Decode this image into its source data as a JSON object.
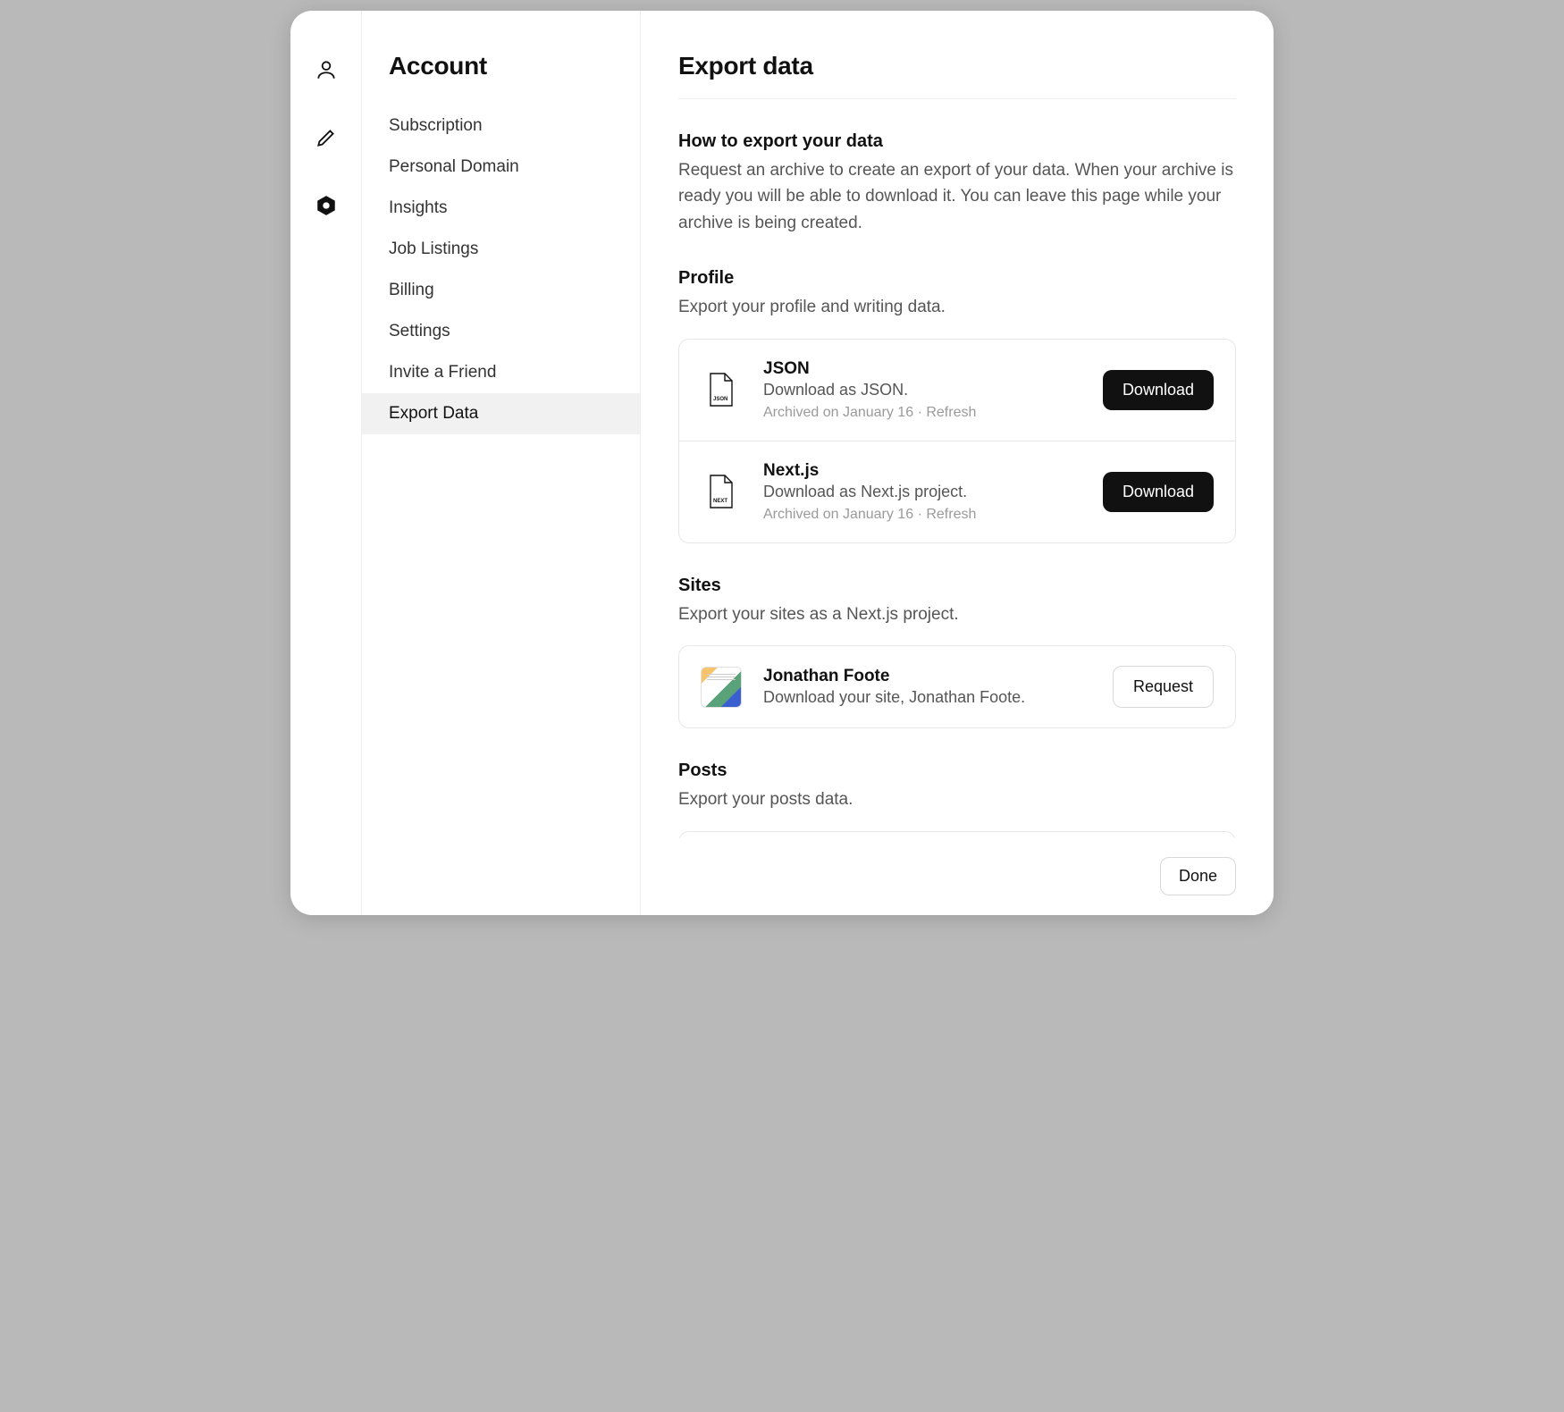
{
  "sidebar": {
    "title": "Account",
    "items": [
      {
        "label": "Subscription",
        "active": false
      },
      {
        "label": "Personal Domain",
        "active": false
      },
      {
        "label": "Insights",
        "active": false
      },
      {
        "label": "Job Listings",
        "active": false
      },
      {
        "label": "Billing",
        "active": false
      },
      {
        "label": "Settings",
        "active": false
      },
      {
        "label": "Invite a Friend",
        "active": false
      },
      {
        "label": "Export Data",
        "active": true
      }
    ]
  },
  "iconrail": {
    "profile": "profile",
    "edit": "edit",
    "settings": "settings"
  },
  "main": {
    "title": "Export data",
    "howto": {
      "heading": "How to export your data",
      "body": "Request an archive to create an export of your data. When your archive is ready you will be able to download it. You can leave this page while your archive is being created."
    },
    "profile": {
      "heading": "Profile",
      "desc": "Export your profile and writing data.",
      "items": [
        {
          "icon_label": "JSON",
          "title": "JSON",
          "sub": "Download as JSON.",
          "archived": "Archived on January 16",
          "refresh": "Refresh",
          "action": "Download",
          "action_style": "dark"
        },
        {
          "icon_label": "NEXT",
          "title": "Next.js",
          "sub": "Download as Next.js project.",
          "archived": "Archived on January 16",
          "refresh": "Refresh",
          "action": "Download",
          "action_style": "dark"
        }
      ]
    },
    "sites": {
      "heading": "Sites",
      "desc": "Export your sites as a Next.js project.",
      "items": [
        {
          "title": "Jonathan Foote",
          "sub": "Download your site, Jonathan Foote.",
          "action": "Request",
          "action_style": "outline"
        }
      ]
    },
    "posts": {
      "heading": "Posts",
      "desc": "Export your posts data."
    },
    "footer": {
      "done": "Done"
    }
  }
}
